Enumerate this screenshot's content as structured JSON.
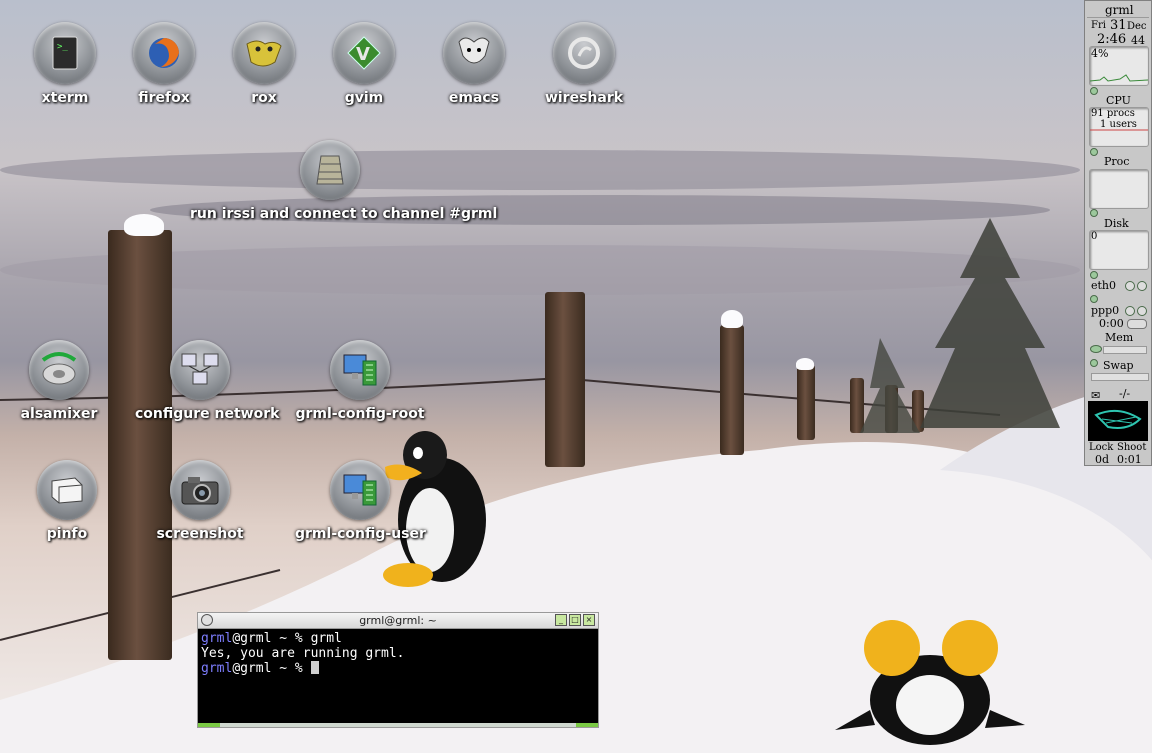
{
  "desktop": {
    "icons": [
      {
        "label": "xterm",
        "icon": "terminal-icon"
      },
      {
        "label": "firefox",
        "icon": "firefox-icon"
      },
      {
        "label": "rox",
        "icon": "rox-icon"
      },
      {
        "label": "gvim",
        "icon": "vim-icon"
      },
      {
        "label": "emacs",
        "icon": "gnu-icon"
      },
      {
        "label": "wireshark",
        "icon": "wireshark-icon"
      },
      {
        "label": "run irssi and connect to channel #grml",
        "icon": "irssi-icon"
      },
      {
        "label": "alsamixer",
        "icon": "speaker-icon"
      },
      {
        "label": "configure network",
        "icon": "network-icon"
      },
      {
        "label": "grml-config-root",
        "icon": "config-icon"
      },
      {
        "label": "pinfo",
        "icon": "book-icon"
      },
      {
        "label": "screenshot",
        "icon": "camera-icon"
      },
      {
        "label": "grml-config-user",
        "icon": "config-icon"
      }
    ]
  },
  "gkrellm": {
    "hostname": "grml",
    "date_day": "Fri",
    "date_num": "31",
    "date_month": "Dec",
    "time": "2:46",
    "seconds": "44",
    "cpu_percent": "4%",
    "cpu_label": "CPU",
    "procs": "91 procs",
    "users": "1 users",
    "proc_label": "Proc",
    "disk_label": "Disk",
    "disk_value": "0",
    "eth0_label": "eth0",
    "ppp0_label": "ppp0",
    "ppp0_time": "0:00",
    "mem_label": "Mem",
    "swap_label": "Swap",
    "mail_value": "-/-",
    "lock_label": "Lock",
    "shoot_label": "Shoot",
    "uptime_days": "0d",
    "uptime_time": "0:01"
  },
  "terminal": {
    "title": "grml@grml: ~",
    "lines": [
      {
        "user": "grml",
        "rest": "@grml ~ % grml"
      },
      {
        "output": "Yes, you are running grml."
      },
      {
        "user": "grml",
        "rest": "@grml ~ % "
      }
    ]
  },
  "colors": {
    "prompt_user": "#7e7eff",
    "led_green": "#7ac943"
  }
}
